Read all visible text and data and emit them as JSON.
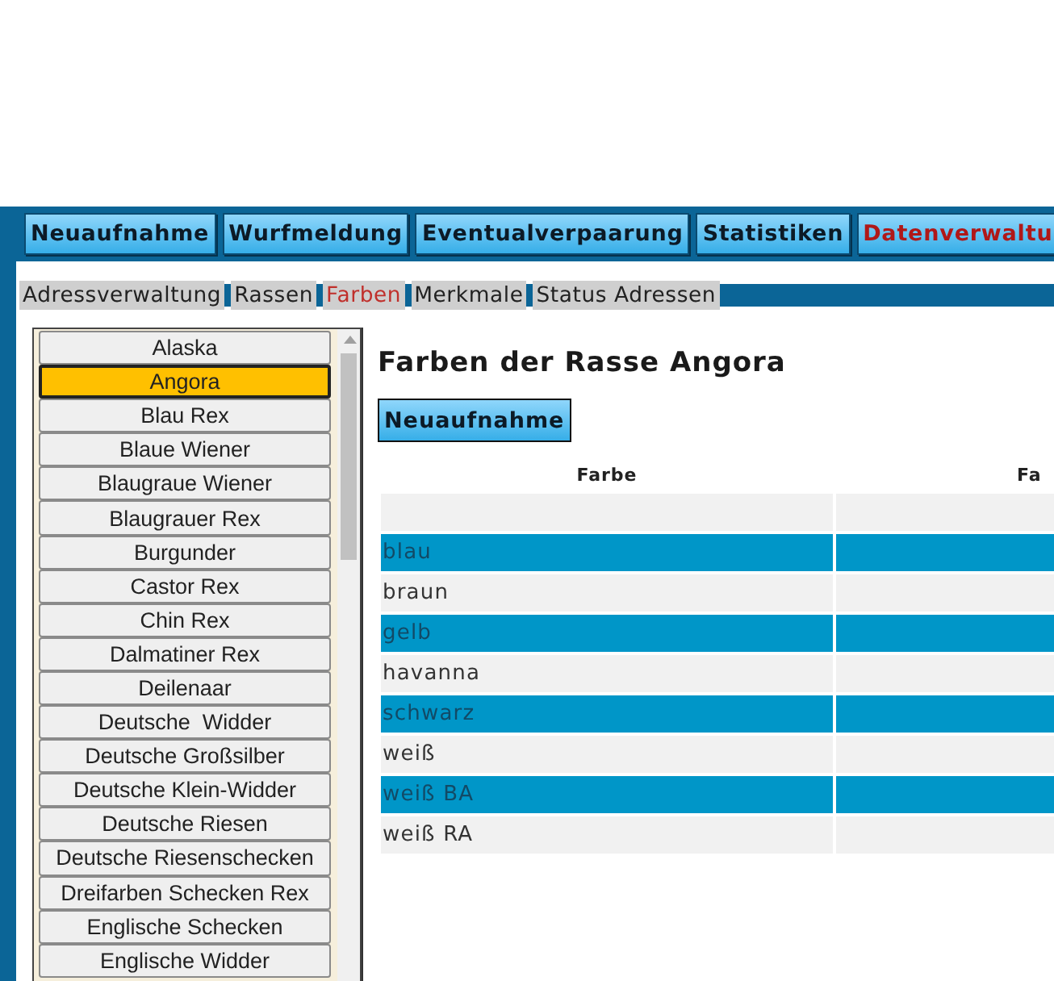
{
  "main_nav": [
    {
      "label": "Neuaufnahme",
      "selected": false
    },
    {
      "label": "Wurfmeldung",
      "selected": false
    },
    {
      "label": "Eventualverpaarung",
      "selected": false
    },
    {
      "label": "Statistiken",
      "selected": false
    },
    {
      "label": "Datenverwaltu",
      "selected": true
    }
  ],
  "sub_tabs": [
    {
      "label": "Adressverwaltung",
      "selected": false
    },
    {
      "label": "Rassen",
      "selected": false
    },
    {
      "label": "Farben",
      "selected": true
    },
    {
      "label": "Merkmale",
      "selected": false
    },
    {
      "label": "Status Adressen",
      "selected": false
    }
  ],
  "breeds": [
    {
      "label": "Alaska",
      "selected": false
    },
    {
      "label": "Angora",
      "selected": true
    },
    {
      "label": "Blau Rex",
      "selected": false
    },
    {
      "label": "Blaue Wiener",
      "selected": false
    },
    {
      "label": "Blaugraue Wiener",
      "selected": false
    },
    {
      "label": "Blaugrauer Rex",
      "selected": false
    },
    {
      "label": "Burgunder",
      "selected": false
    },
    {
      "label": "Castor Rex",
      "selected": false
    },
    {
      "label": "Chin Rex",
      "selected": false
    },
    {
      "label": "Dalmatiner Rex",
      "selected": false
    },
    {
      "label": "Deilenaar",
      "selected": false
    },
    {
      "label": "Deutsche  Widder",
      "selected": false
    },
    {
      "label": "Deutsche Großsilber",
      "selected": false
    },
    {
      "label": "Deutsche Klein-Widder",
      "selected": false
    },
    {
      "label": "Deutsche Riesen",
      "selected": false
    },
    {
      "label": "Deutsche Riesenschecken",
      "selected": false
    },
    {
      "label": "Dreifarben Schecken Rex",
      "selected": false
    },
    {
      "label": "Englische Schecken",
      "selected": false
    },
    {
      "label": "Englische Widder",
      "selected": false
    }
  ],
  "content": {
    "title": "Farben der Rasse Angora",
    "new_button": "Neuaufnahme",
    "table": {
      "columns": [
        "Farbe",
        "Fa"
      ],
      "rows": [
        {
          "farbe": "",
          "highlighted": false
        },
        {
          "farbe": "blau",
          "highlighted": true
        },
        {
          "farbe": "braun",
          "highlighted": false
        },
        {
          "farbe": "gelb",
          "highlighted": true
        },
        {
          "farbe": "havanna",
          "highlighted": false
        },
        {
          "farbe": "schwarz",
          "highlighted": true
        },
        {
          "farbe": "weiß",
          "highlighted": false
        },
        {
          "farbe": "weiß BA",
          "highlighted": true
        },
        {
          "farbe": "weiß RA",
          "highlighted": false
        }
      ]
    }
  }
}
